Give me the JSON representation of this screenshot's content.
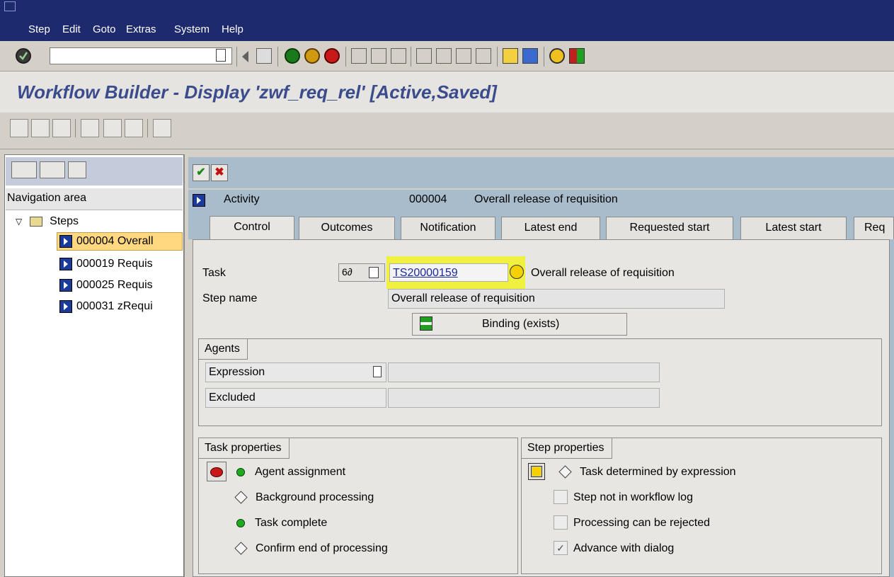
{
  "menu": {
    "items": [
      "Step",
      "Edit",
      "Goto",
      "Extras",
      "System",
      "Help"
    ]
  },
  "title": "Workflow Builder - Display 'zwf_req_rel' [Active,Saved]",
  "nav": {
    "header": "Navigation area",
    "folder": "Steps",
    "items": [
      "000004 Overall",
      "000019 Requis",
      "000025 Requis",
      "000031 zRequi"
    ]
  },
  "activity": {
    "label": "Activity",
    "number": "000004",
    "description": "Overall release of requisition"
  },
  "tabs": [
    "Control",
    "Outcomes",
    "Notification",
    "Latest end",
    "Requested start",
    "Latest start",
    "Req"
  ],
  "form": {
    "task_label": "Task",
    "task_value": "TS20000159",
    "task_description": "Overall release of requisition",
    "step_name_label": "Step name",
    "step_name_value": "Overall release of requisition",
    "binding_button": "Binding (exists)"
  },
  "agents": {
    "title": "Agents",
    "expression_label": "Expression",
    "excluded_label": "Excluded"
  },
  "task_properties": {
    "title": "Task properties",
    "items": [
      "Agent assignment",
      "Background processing",
      "Task complete",
      "Confirm end of processing"
    ]
  },
  "step_properties": {
    "title": "Step properties",
    "determined": "Task determined by expression",
    "checks": [
      "Step not in workflow log",
      "Processing can be rejected",
      "Advance with dialog"
    ],
    "checked": [
      false,
      false,
      true
    ]
  },
  "colors": {
    "menubar": "#1e2a6e",
    "title": "#3a4c8c",
    "header_band": "#a8bccc",
    "highlight": "#f0f040",
    "selected_nav": "#ffd880"
  }
}
